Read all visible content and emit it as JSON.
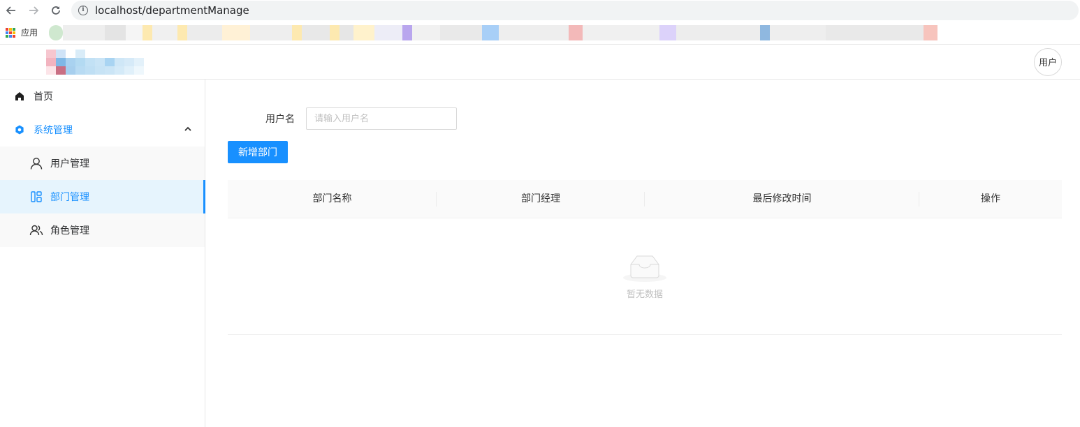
{
  "browser": {
    "url": "localhost/departmentManage",
    "bookmarks_apps_label": "应用"
  },
  "header": {
    "avatar_label": "用户"
  },
  "sidebar": {
    "home_label": "首页",
    "system_label": "系统管理",
    "sub_items": [
      {
        "label": "用户管理",
        "icon": "user-icon"
      },
      {
        "label": "部门管理",
        "icon": "department-icon"
      },
      {
        "label": "角色管理",
        "icon": "team-icon"
      }
    ]
  },
  "filter": {
    "username_label": "用户名",
    "username_placeholder": "请输入用户名"
  },
  "toolbar": {
    "add_label": "新增部门"
  },
  "table": {
    "columns": [
      "部门名称",
      "部门经理",
      "最后修改时间",
      "操作"
    ],
    "empty_text": "暂无数据"
  },
  "colors": {
    "primary": "#1890ff",
    "selected_bg": "#e6f4fd"
  }
}
